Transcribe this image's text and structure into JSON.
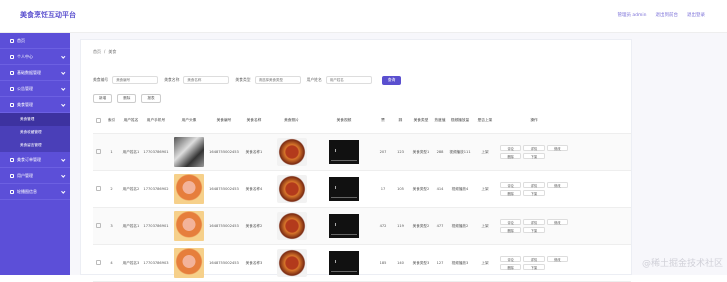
{
  "app": {
    "title": "美食烹饪互动平台"
  },
  "top_links": [
    "管理员 admin",
    "退出到前台",
    "退出登录"
  ],
  "sidebar": {
    "items": [
      {
        "label": "首页",
        "has_arrow": false
      },
      {
        "label": "个人中心",
        "has_arrow": true
      },
      {
        "label": "基础数据管理",
        "has_arrow": true
      },
      {
        "label": "公告管理",
        "has_arrow": true
      },
      {
        "label": "美食管理",
        "has_arrow": true
      }
    ],
    "sub_items": [
      "美食管理",
      "美食收藏管理",
      "美食留言管理"
    ],
    "items_after": [
      {
        "label": "美食订单管理",
        "has_arrow": true
      },
      {
        "label": "用户管理",
        "has_arrow": true
      },
      {
        "label": "轮播图信息",
        "has_arrow": true
      }
    ]
  },
  "breadcrumb": [
    "首页",
    "/",
    "美食"
  ],
  "search": {
    "fields": [
      {
        "label": "美食编号",
        "placeholder": "美食编号"
      },
      {
        "label": "美食名称",
        "placeholder": "美食名称"
      },
      {
        "label": "美食类型",
        "placeholder": "请选择美食类型"
      },
      {
        "label": "用户姓名",
        "placeholder": "用户姓名"
      }
    ],
    "button": "查询"
  },
  "actions": [
    "新增",
    "删除",
    "报表"
  ],
  "table": {
    "headers": [
      "",
      "索引",
      "用户姓名",
      "用户手机号",
      "用户头像",
      "美食编号",
      "美食名称",
      "美食照片",
      "美食视频",
      "赞",
      "踩",
      "美食类型",
      "热度值",
      "视频播放量",
      "是否上架",
      "操作"
    ],
    "rows": [
      {
        "index": "1",
        "user": "用户姓名1",
        "phone": "17703786901",
        "avatar": "bw",
        "code": "1648755002453",
        "name": "美食名称1",
        "likes": "207",
        "dislikes": "123",
        "type": "美食类型1",
        "heat": "288",
        "plays": "视频播放111",
        "status": "上架"
      },
      {
        "index": "2",
        "user": "用户姓名2",
        "phone": "17703786902",
        "avatar": "color",
        "code": "1648755002453",
        "name": "美食名称4",
        "likes": "17",
        "dislikes": "105",
        "type": "美食类型2",
        "heat": "414",
        "plays": "视频播放4",
        "status": "上架"
      },
      {
        "index": "3",
        "user": "用户姓名1",
        "phone": "17703786901",
        "avatar": "color",
        "code": "1648755002453",
        "name": "美食名称2",
        "likes": "472",
        "dislikes": "119",
        "type": "美食类型2",
        "heat": "477",
        "plays": "视频播放2",
        "status": "上架"
      },
      {
        "index": "4",
        "user": "用户姓名3",
        "phone": "17703786903",
        "avatar": "color",
        "code": "1648755002453",
        "name": "美食名称3",
        "likes": "185",
        "dislikes": "140",
        "type": "美食类型3",
        "heat": "127",
        "plays": "视频播放3",
        "status": "上架"
      }
    ],
    "row_ops": [
      "评论",
      "详情",
      "修改",
      "删除",
      "下架"
    ]
  },
  "watermark": "@稀土掘金技术社区"
}
